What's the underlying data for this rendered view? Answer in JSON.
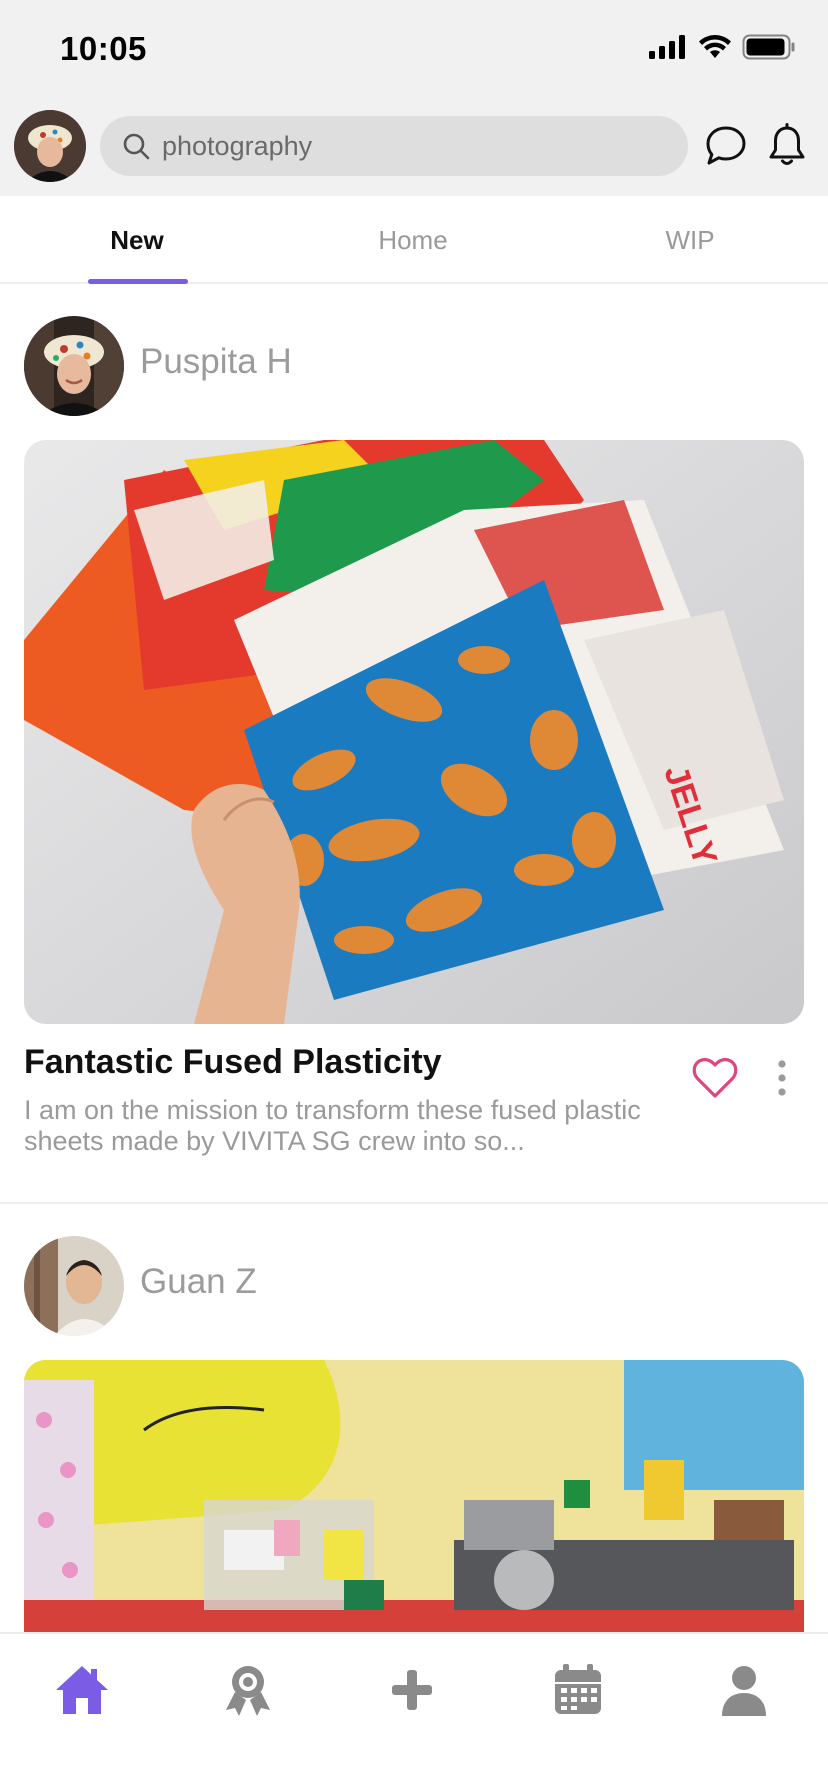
{
  "status_bar": {
    "time": "10:05"
  },
  "search": {
    "value": "photography"
  },
  "tabs": [
    {
      "label": "New",
      "active": true
    },
    {
      "label": "Home",
      "active": false
    },
    {
      "label": "WIP",
      "active": false
    }
  ],
  "posts": [
    {
      "author": "Puspita H",
      "title": "Fantastic Fused Plasticity",
      "description": "I am on the mission to transform these fused plastic sheets made by VIVITA SG crew into so...",
      "liked": false
    },
    {
      "author": "Guan Z"
    }
  ],
  "bottom_nav": [
    {
      "icon": "home-icon",
      "active": true
    },
    {
      "icon": "award-icon",
      "active": false
    },
    {
      "icon": "plus-icon",
      "active": false
    },
    {
      "icon": "calendar-icon",
      "active": false
    },
    {
      "icon": "profile-icon",
      "active": false
    }
  ],
  "colors": {
    "accent": "#7a5ce5",
    "heart": "#e0457b",
    "inactive": "#8a8a8a"
  }
}
